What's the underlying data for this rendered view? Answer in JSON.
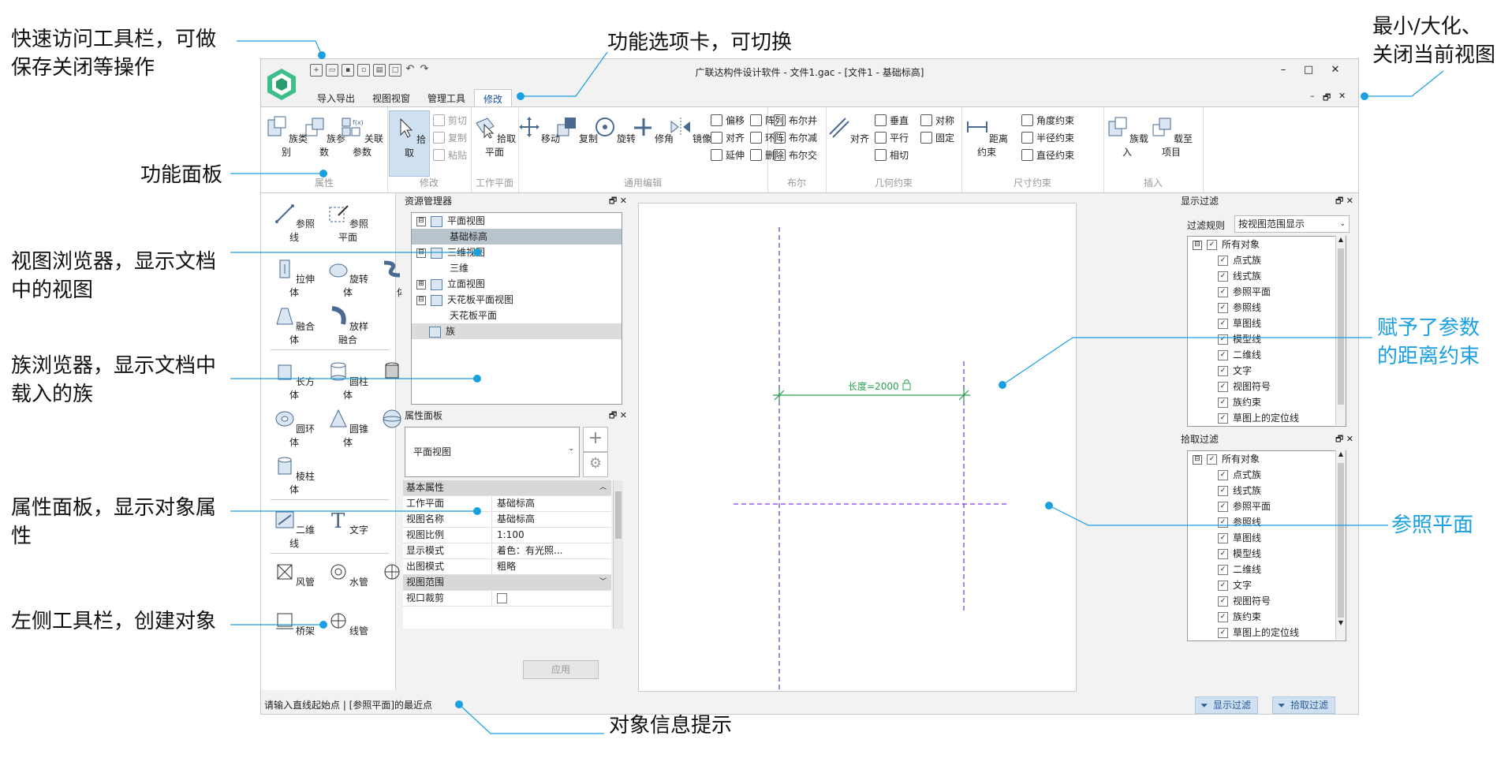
{
  "callouts": {
    "qat": "快速访问工具栏，可做\n保存关闭等操作",
    "tabs": "功能选项卡，可切换",
    "winctl": "最小/大化、\n关闭当前视图",
    "ribbon": "功能面板",
    "view_browser": "视图浏览器，显示文档\n中的视图",
    "family_browser": "族浏览器，显示文档中\n载入的族",
    "props": "属性面板，显示对象属\n性",
    "lefttool": "左侧工具栏，创建对象",
    "param": "赋予了参数\n的距离约束",
    "refplane": "参照平面",
    "status": "对象信息提示"
  },
  "colors": {
    "accent": "#1aa0e0",
    "dim": "#2aa050",
    "ref": "#7a3ee0"
  },
  "window": {
    "title": "广联达构件设计软件 - 文件1.gac - [文件1 - 基础标高]",
    "min": "–",
    "max": "□",
    "close": "✕",
    "doc_min": "–",
    "doc_restore": "🗗",
    "doc_close": "✕"
  },
  "tabs": [
    "导入导出",
    "视图视窗",
    "管理工具",
    "修改"
  ],
  "ribbon": {
    "groups": {
      "attr": "属性",
      "modify": "修改",
      "workplane": "工作平面",
      "edit": "通用编辑",
      "bool": "布尔",
      "geo": "几何约束",
      "dim": "尺寸约束",
      "insert": "插入"
    },
    "attr_btns": [
      "族类别",
      "族参数",
      "关联参数"
    ],
    "pick": "拾取",
    "clip": [
      "剪切",
      "复制",
      "粘贴"
    ],
    "pickplane": "拾取平面",
    "edit_btns": [
      "移动",
      "复制",
      "旋转",
      "修角",
      "镜像"
    ],
    "edit_small": [
      "偏移",
      "阵列",
      "对齐",
      "环阵",
      "延伸",
      "删除"
    ],
    "bool_small": [
      "布尔并",
      "布尔减",
      "布尔交"
    ],
    "align": "对齐",
    "geo_small": [
      "垂直",
      "对称",
      "平行",
      "固定",
      "相切"
    ],
    "dimcons": "距离约束",
    "dim_small": [
      "角度约束",
      "半径约束",
      "直径约束"
    ],
    "insert_btns": [
      "族载入",
      "载至项目"
    ]
  },
  "lefttools": {
    "row1": [
      "参照线",
      "参照平面"
    ],
    "row2": [
      "拉伸体",
      "旋转体",
      "放样体"
    ],
    "row3": [
      "融合体",
      "放样融合"
    ],
    "row4": [
      "长方体",
      "圆柱体",
      "管体"
    ],
    "row5": [
      "圆环体",
      "圆锥体",
      "球体"
    ],
    "row6": [
      "棱柱体"
    ],
    "row7": [
      "二维线",
      "文字"
    ],
    "row8": [
      "风管",
      "水管",
      "电气"
    ],
    "row9": [
      "桥架",
      "线管"
    ]
  },
  "resource": {
    "title": "资源管理器",
    "tree": [
      "平面视图",
      "基础标高",
      "三维视图",
      "三维",
      "立面视图",
      "天花板平面视图",
      "天花板平面",
      "族"
    ],
    "expanders": [
      "⊟",
      "⊟",
      "⊞",
      "⊟"
    ]
  },
  "props": {
    "title": "属性面板",
    "type": "平面视图",
    "section1": "基本属性",
    "rows": [
      {
        "k": "工作平面",
        "v": "基础标高"
      },
      {
        "k": "视图名称",
        "v": "基础标高"
      },
      {
        "k": "视图比例",
        "v": "1:100"
      },
      {
        "k": "显示模式",
        "v": "着色：有光照..."
      },
      {
        "k": "出图模式",
        "v": "粗略"
      }
    ],
    "section2": "视图范围",
    "row_crop": "视口裁剪",
    "apply": "应用"
  },
  "canvas": {
    "dimension": "长度=2000"
  },
  "display_filter": {
    "title": "显示过滤",
    "rule_label": "过滤规则",
    "rule_value": "按视图范围显示",
    "root": "所有对象",
    "items": [
      "点式族",
      "线式族",
      "参照平面",
      "参照线",
      "草图线",
      "模型线",
      "二维线",
      "文字",
      "视图符号",
      "族约束",
      "草图上的定位线"
    ]
  },
  "pick_filter": {
    "title": "拾取过滤",
    "root": "所有对象",
    "items": [
      "点式族",
      "线式族",
      "参照平面",
      "参照线",
      "草图线",
      "模型线",
      "二维线",
      "文字",
      "视图符号",
      "族约束",
      "草图上的定位线"
    ]
  },
  "status": {
    "hint": "请输入直线起始点 | [参照平面]的最近点",
    "btn_display": "显示过滤",
    "btn_pick": "拾取过滤"
  }
}
